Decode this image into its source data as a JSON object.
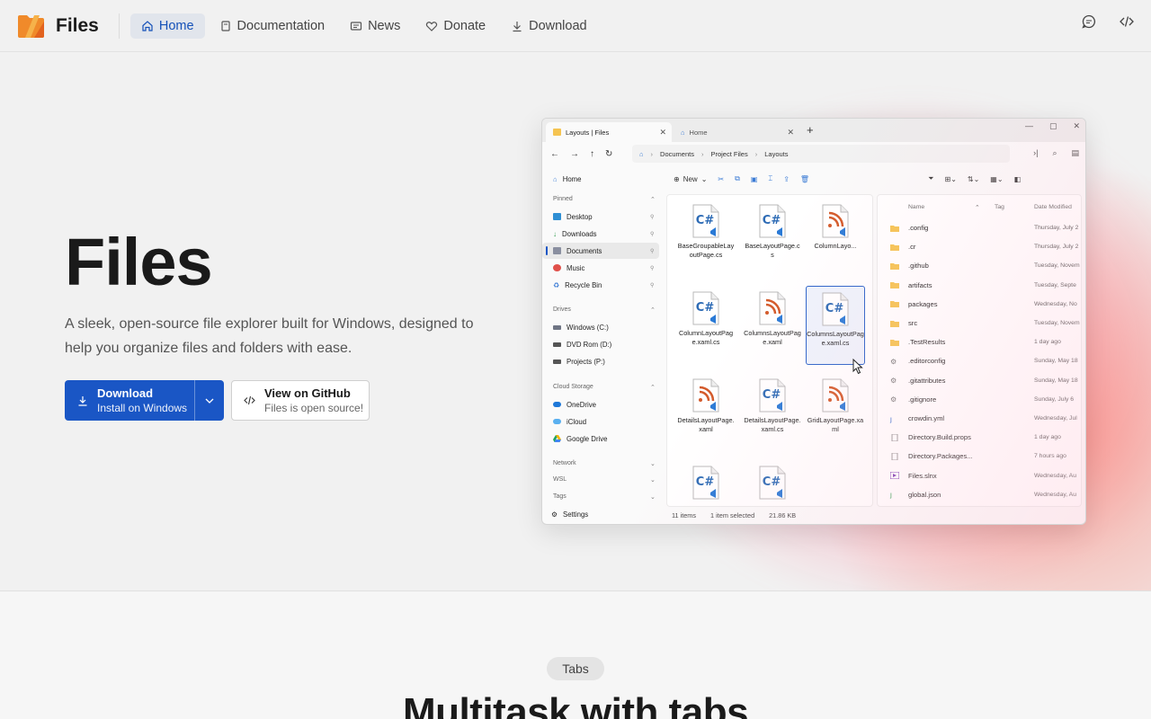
{
  "brand": {
    "name": "Files"
  },
  "nav": {
    "links": [
      {
        "label": "Home"
      },
      {
        "label": "Documentation"
      },
      {
        "label": "News"
      },
      {
        "label": "Donate"
      },
      {
        "label": "Download"
      }
    ]
  },
  "hero": {
    "title": "Files",
    "description": "A sleek, open-source file explorer built for Windows, designed to help you organize files and folders with ease.",
    "download": {
      "title": "Download",
      "subtitle": "Install on Windows"
    },
    "github": {
      "title": "View on GitHub",
      "subtitle": "Files is open source!"
    }
  },
  "app": {
    "tabs": [
      {
        "label": "Layouts | Files"
      },
      {
        "label": "Home"
      }
    ],
    "breadcrumb": [
      "Documents",
      "Project Files",
      "Layouts"
    ],
    "sidebar": {
      "home": "Home",
      "pinned_label": "Pinned",
      "pinned": [
        "Desktop",
        "Downloads",
        "Documents",
        "Music",
        "Recycle Bin"
      ],
      "drives_label": "Drives",
      "drives": [
        "Windows (C:)",
        "DVD Rom (D:)",
        "Projects (P:)"
      ],
      "cloud_label": "Cloud Storage",
      "cloud": [
        "OneDrive",
        "iCloud",
        "Google Drive"
      ],
      "network_label": "Network",
      "wsl_label": "WSL",
      "tags_label": "Tags",
      "settings": "Settings"
    },
    "toolbar": {
      "new_label": "New"
    },
    "grid_items": [
      {
        "name": "BaseGroupableLayoutPage.cs",
        "kind": "cs"
      },
      {
        "name": "BaseLayoutPage.cs",
        "kind": "cs"
      },
      {
        "name": "ColumnLayo...",
        "kind": "xaml"
      },
      {
        "name": "ColumnLayoutPage.xaml.cs",
        "kind": "cs"
      },
      {
        "name": "ColumnsLayoutPage.xaml",
        "kind": "xaml"
      },
      {
        "name": "ColumnsLayoutPage.xaml.cs",
        "kind": "cs"
      },
      {
        "name": "DetailsLayoutPage.xaml",
        "kind": "xaml"
      },
      {
        "name": "DetailsLayoutPage.xaml.cs",
        "kind": "cs"
      },
      {
        "name": "GridLayoutPage.xaml",
        "kind": "xaml"
      },
      {
        "name": "",
        "kind": "cs"
      },
      {
        "name": "",
        "kind": "cs"
      }
    ],
    "details_headers": {
      "name": "Name",
      "tag": "Tag",
      "date": "Date Modified"
    },
    "details_rows": [
      {
        "name": ".config",
        "date": "Thursday, July 2",
        "kind": "folder"
      },
      {
        "name": ".cr",
        "date": "Thursday, July 2",
        "kind": "folder"
      },
      {
        "name": ".github",
        "date": "Tuesday, Novem",
        "kind": "folder"
      },
      {
        "name": "artifacts",
        "date": "Tuesday, Septe",
        "kind": "folder"
      },
      {
        "name": "packages",
        "date": "Wednesday, No",
        "kind": "folder"
      },
      {
        "name": "src",
        "date": "Tuesday, Novem",
        "kind": "folder"
      },
      {
        "name": ".TestResults",
        "date": "1 day ago",
        "kind": "folder"
      },
      {
        "name": ".editorconfig",
        "date": "Sunday, May 18",
        "kind": "gear"
      },
      {
        "name": ".gitattributes",
        "date": "Sunday, May 18",
        "kind": "gear"
      },
      {
        "name": ".gitignore",
        "date": "Sunday, July 6",
        "kind": "gear"
      },
      {
        "name": "crowdin.yml",
        "date": "Wednesday, Jul",
        "kind": "yml"
      },
      {
        "name": "Directory.Build.props",
        "date": "1 day ago",
        "kind": "file"
      },
      {
        "name": "Directory.Packages...",
        "date": "7 hours ago",
        "kind": "file"
      },
      {
        "name": "Files.slnx",
        "date": "Wednesday, Au",
        "kind": "sln"
      },
      {
        "name": "global.json",
        "date": "Wednesday, Au",
        "kind": "json"
      }
    ],
    "status": {
      "items": "11 items",
      "selected": "1 item selected",
      "size": "21.86 KB"
    }
  },
  "section2": {
    "pill": "Tabs",
    "title": "Multitask with tabs"
  },
  "colors": {
    "accent": "#1a56c5",
    "folder": "#f5c451",
    "cs": "#2d6bb5",
    "xaml": "#d35a2a"
  }
}
